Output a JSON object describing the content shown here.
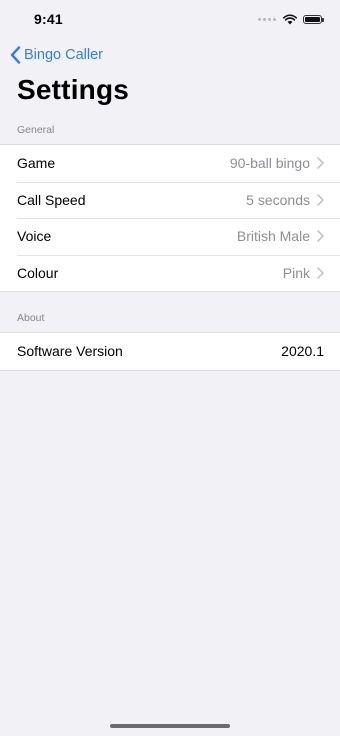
{
  "status_bar": {
    "time": "9:41"
  },
  "nav": {
    "back_label": "Bingo Caller"
  },
  "page_title": "Settings",
  "sections": {
    "general": {
      "header": "General",
      "rows": [
        {
          "label": "Game",
          "value": "90-ball bingo"
        },
        {
          "label": "Call Speed",
          "value": "5 seconds"
        },
        {
          "label": "Voice",
          "value": "British Male"
        },
        {
          "label": "Colour",
          "value": "Pink"
        }
      ]
    },
    "about": {
      "header": "About",
      "rows": [
        {
          "label": "Software Version",
          "value": "2020.1"
        }
      ]
    }
  },
  "colors": {
    "accent": "#2f7df6",
    "background": "#f2f1f6",
    "secondary_text": "#8e8e93"
  }
}
